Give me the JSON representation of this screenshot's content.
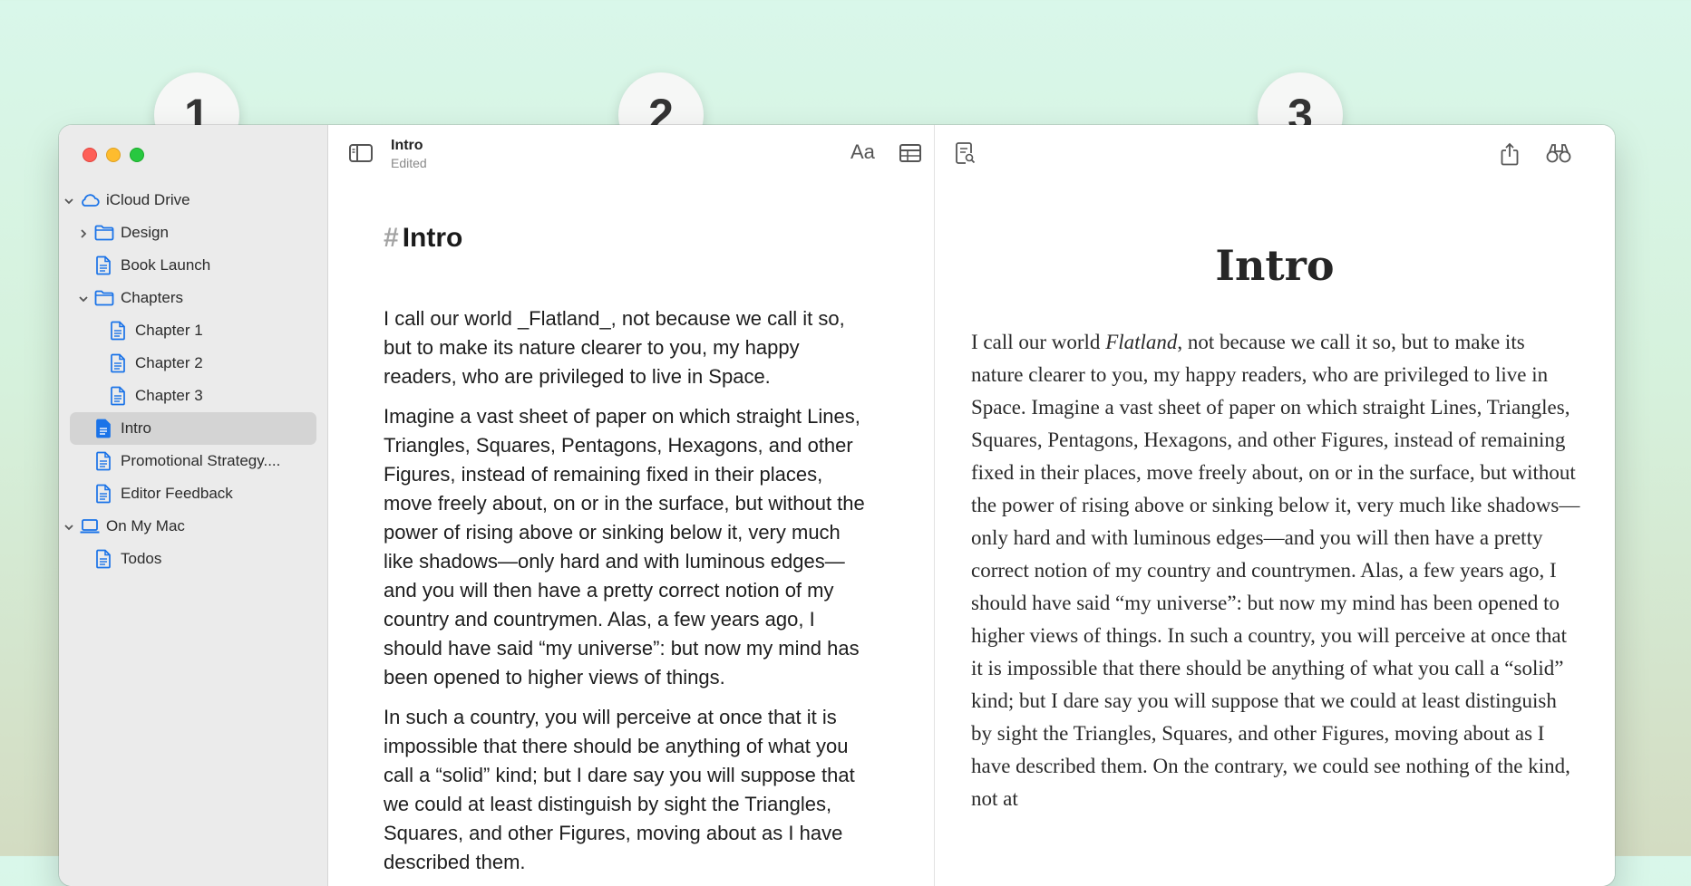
{
  "callouts": [
    "1",
    "2",
    "3"
  ],
  "sidebar": {
    "items": [
      {
        "label": "iCloud Drive",
        "kind": "cloud",
        "chevron": "down",
        "level": 0
      },
      {
        "label": "Design",
        "kind": "folder",
        "chevron": "right",
        "level": 1
      },
      {
        "label": "Book Launch",
        "kind": "doc",
        "chevron": "",
        "level": 1
      },
      {
        "label": "Chapters",
        "kind": "folder",
        "chevron": "down",
        "level": 1
      },
      {
        "label": "Chapter 1",
        "kind": "doc",
        "chevron": "",
        "level": 2
      },
      {
        "label": "Chapter 2",
        "kind": "doc",
        "chevron": "",
        "level": 2
      },
      {
        "label": "Chapter 3",
        "kind": "doc",
        "chevron": "",
        "level": 2
      },
      {
        "label": "Intro",
        "kind": "doc",
        "chevron": "",
        "level": 1,
        "selected": true
      },
      {
        "label": "Promotional Strategy....",
        "kind": "doc",
        "chevron": "",
        "level": 1
      },
      {
        "label": "Editor Feedback",
        "kind": "doc",
        "chevron": "",
        "level": 1
      },
      {
        "label": "On My Mac",
        "kind": "laptop",
        "chevron": "down",
        "level": 0
      },
      {
        "label": "Todos",
        "kind": "doc",
        "chevron": "",
        "level": 1
      }
    ]
  },
  "editor": {
    "title": "Intro",
    "status": "Edited",
    "heading_marker": "#",
    "heading": "Intro",
    "paragraphs": [
      "I call our world _Flatland_, not because we call it so, but to make its nature clearer to you, my happy readers, who are privileged to live in Space.",
      "Imagine a vast sheet of paper on which straight Lines, Triangles, Squares, Pentagons, Hexagons, and other Figures, instead of remaining fixed in their places, move freely about, on or in the surface, but without the power of rising above or sinking below it, very much like shadows—only hard and with luminous edges—and you will then have a pretty correct notion of my country and countrymen. Alas, a few years ago, I should have said “my universe”: but now my mind has been opened to higher views of things.",
      "In such a country, you will perceive at once that it is impossible that there should be anything of what you call a “solid” kind; but I dare say you will suppose that we could at least distinguish by sight the Triangles, Squares, and other Figures, moving about as I have described them."
    ]
  },
  "preview": {
    "title": "Intro",
    "p_before_italic": "I call our world ",
    "p_italic": "Flatland",
    "p_after_italic": ", not because we call it so, but to make its nature clearer to you, my happy readers, who are privileged to live in Space. Imagine a vast sheet of paper on which straight Lines, Triangles, Squares, Pentagons, Hexagons, and other Figures, instead of remaining fixed in their places, move freely about, on or in the surface, but without the power of rising above or sinking below it, very much like shadows—only hard and with luminous edges—and you will then have a pretty correct notion of my country and countrymen. Alas, a few years ago, I should have said “my universe”: but now my mind has been opened to higher views of things. In such a country, you will perceive at once that it is impossible that there should be anything of what you call a “solid” kind; but I dare say you will suppose that we could at least distinguish by sight the Triangles, Squares, and other Figures, moving about as I have described them. On the contrary, we could see nothing of the kind, not at"
  },
  "colors": {
    "accent": "#1a73e8",
    "sidebar_bg": "#ebebeb",
    "selected_bg": "#d4d4d4"
  }
}
